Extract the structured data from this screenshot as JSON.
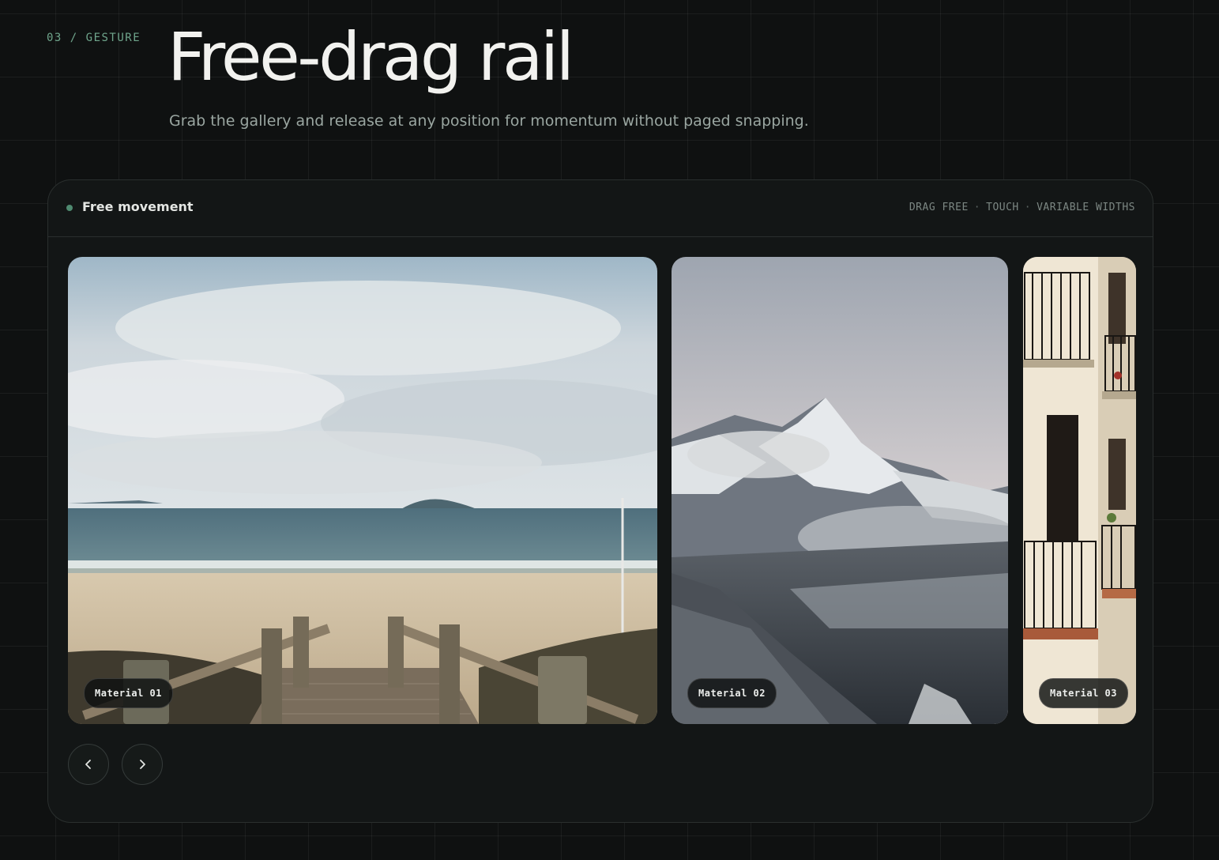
{
  "section": {
    "eyebrow": "03 / GESTURE",
    "title": "Free-drag rail",
    "subtitle": "Grab the gallery and release at any position for momentum without paged snapping."
  },
  "panel": {
    "title": "Free movement",
    "tags": [
      "DRAG FREE",
      "TOUCH",
      "VARIABLE WIDTHS"
    ],
    "tag_separator": "·"
  },
  "slides": [
    {
      "label": "Material 01",
      "scene": "beach-boardwalk"
    },
    {
      "label": "Material 02",
      "scene": "snowy-mountain"
    },
    {
      "label": "Material 03",
      "scene": "building-balconies"
    }
  ],
  "controls": {
    "prev_icon": "chevron-left-icon",
    "next_icon": "chevron-right-icon"
  },
  "colors": {
    "background": "#0f1111",
    "panel": "#131616",
    "accent": "#6fa58c",
    "text": "#f2f2ef"
  }
}
